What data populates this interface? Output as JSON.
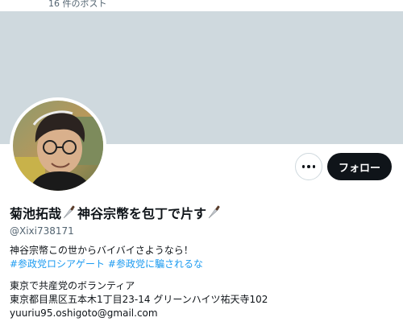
{
  "header": {
    "post_count": "16 件のポスト"
  },
  "profile": {
    "name_part1": "菊池拓哉",
    "name_part2": "神谷宗幣を包丁で片す",
    "handle": "@Xixi738171",
    "follow_label": "フォロー",
    "more_icon": "more-horizontal-icon",
    "name_icon": "kitchen-knife-icon"
  },
  "bio": {
    "line1": "神谷宗幣この世からバイバイさようなら！",
    "hashtag1": "#参政党ロシアゲート",
    "hashtag2": "#参政党に騙されるな",
    "line3": "東京で共産党のボランティア",
    "line4": "東京都目黒区五本木1丁目23-14 グリーンハイツ祐天寺102",
    "line5": "yuuriu95.oshigoto@gmail.com"
  },
  "colors": {
    "banner": "#cfd9de",
    "follow_bg": "#0f1419",
    "hashtag": "#1d9bf0",
    "secondary_text": "#536471"
  }
}
